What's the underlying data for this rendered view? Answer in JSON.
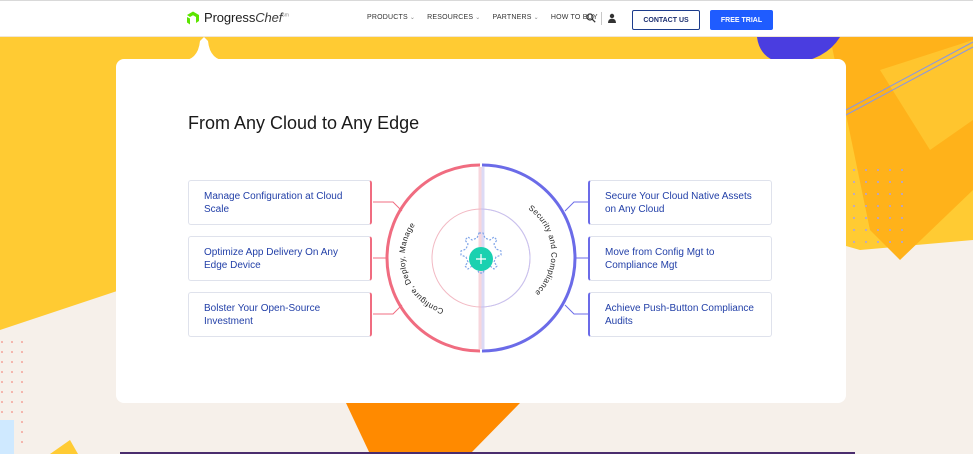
{
  "header": {
    "logo_text": "Progress",
    "logo_chef": "Chef",
    "logo_mark": "sm",
    "nav": [
      {
        "label": "PRODUCTS"
      },
      {
        "label": "RESOURCES"
      },
      {
        "label": "PARTNERS"
      },
      {
        "label": "HOW TO BUY"
      }
    ],
    "contact_label": "CONTACT US",
    "trial_label": "FREE TRIAL"
  },
  "main": {
    "title": "From Any Cloud to Any Edge",
    "left_features": [
      {
        "label": "Manage Configuration at Cloud Scale"
      },
      {
        "label": "Optimize App Delivery On Any Edge Device"
      },
      {
        "label": "Bolster Your Open-Source Investment"
      }
    ],
    "right_features": [
      {
        "label": "Secure Your Cloud Native Assets on Any Cloud"
      },
      {
        "label": "Move from Config Mgt to Compliance Mgt"
      },
      {
        "label": "Achieve Push-Button Compliance Audits"
      }
    ],
    "arc_left_label": "Configure, Deploy, Manage",
    "arc_right_label": "Security and Compliance"
  },
  "colors": {
    "brand_green": "#5ce500",
    "accent_blue": "#1f5cff",
    "arc_red": "#f06c80",
    "arc_purple": "#6b6be8",
    "teal": "#1ad1b0",
    "yellow": "#ffcb33",
    "orange": "#ff8a00"
  }
}
